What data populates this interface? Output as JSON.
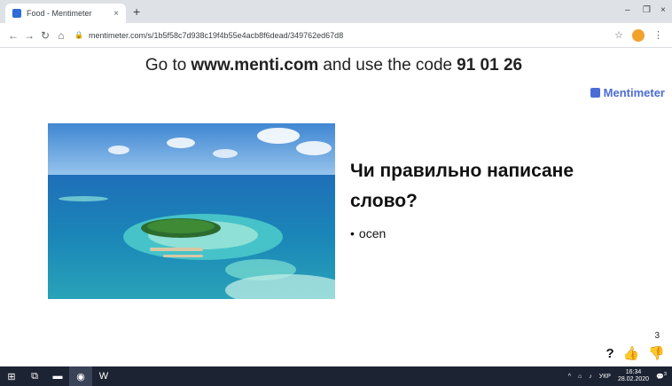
{
  "browser": {
    "tab_title": "Food - Mentimeter",
    "tab_close": "×",
    "new_tab": "+",
    "url": "mentimeter.com/s/1b5f58c7d938c19f4b55e4acb8f6dead/349762ed67d8",
    "minimize": "–",
    "restore": "❐",
    "close": "×"
  },
  "banner": {
    "prefix": "Go to",
    "site": "www.menti.com",
    "middle": "and use the code",
    "code": "91 01 26"
  },
  "brand": {
    "name": "Mentimeter"
  },
  "slide": {
    "question": "Чи правильно написане слово?",
    "answer": "ocen"
  },
  "footer": {
    "help": "?",
    "votes": "3"
  },
  "taskbar": {
    "tray_lang": "УКР",
    "time": "16:34",
    "date": "28.02.2020",
    "notification_count": "3"
  },
  "colors": {
    "accent": "#4b6cd6",
    "taskbar": "#1c2333"
  }
}
